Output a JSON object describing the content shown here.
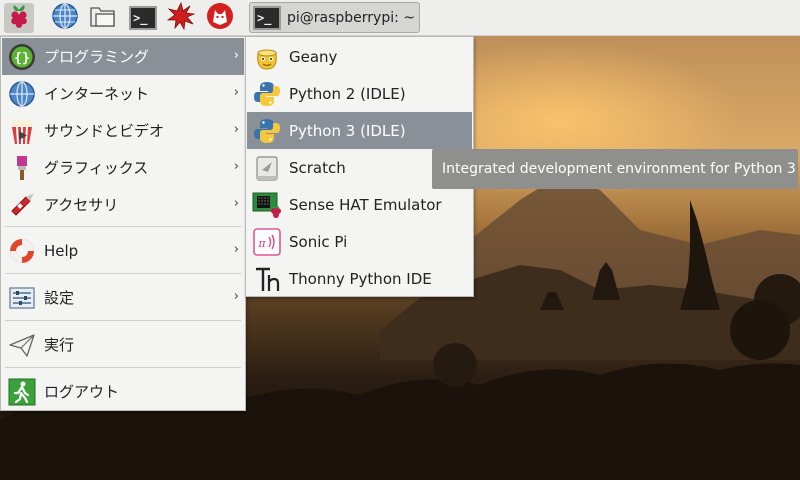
{
  "panel": {
    "launchers": [
      {
        "icon": "raspberry-icon",
        "name": "menu-button"
      },
      {
        "icon": "globe-icon",
        "name": "web-browser-launcher"
      },
      {
        "icon": "folder-icon",
        "name": "file-manager-launcher"
      },
      {
        "icon": "terminal-icon",
        "name": "terminal-launcher"
      },
      {
        "icon": "starburst-icon",
        "name": "mathematica-launcher"
      },
      {
        "icon": "wolf-icon",
        "name": "wolfram-launcher"
      }
    ],
    "task": {
      "title": "pi@raspberrypi: ~"
    }
  },
  "main_menu": {
    "items": [
      {
        "label": "プログラミング",
        "icon": "braces-icon",
        "submenu": true,
        "selected": true
      },
      {
        "label": "インターネット",
        "icon": "globe-icon",
        "submenu": true
      },
      {
        "label": "サウンドとビデオ",
        "icon": "popcorn-icon",
        "submenu": true
      },
      {
        "label": "グラフィックス",
        "icon": "paintbrush-icon",
        "submenu": true
      },
      {
        "label": "アクセサリ",
        "icon": "swiss-knife-icon",
        "submenu": true
      },
      {
        "label": "Help",
        "icon": "lifebuoy-icon",
        "submenu": true
      },
      {
        "label": "設定",
        "icon": "settings-icon",
        "submenu": true
      },
      {
        "label": "実行",
        "icon": "paper-plane-icon",
        "submenu": false
      },
      {
        "label": "ログアウト",
        "icon": "exit-icon",
        "submenu": false
      }
    ],
    "arrow": "›"
  },
  "sub_menu": {
    "items": [
      {
        "label": "Geany",
        "icon": "geany-icon"
      },
      {
        "label": "Python 2 (IDLE)",
        "icon": "python-icon"
      },
      {
        "label": "Python 3 (IDLE)",
        "icon": "python-icon",
        "selected": true
      },
      {
        "label": "Scratch",
        "icon": "scratch-icon"
      },
      {
        "label": "Sense HAT Emulator",
        "icon": "sense-hat-icon"
      },
      {
        "label": "Sonic Pi",
        "icon": "sonic-pi-icon"
      },
      {
        "label": "Thonny Python IDE",
        "icon": "thonny-icon"
      }
    ]
  },
  "tooltip": {
    "text": "Integrated development environment for Python 3"
  },
  "colors": {
    "selection": "#8a9097",
    "panel_bg": "#eeeeec",
    "menu_bg": "#f4f4f3",
    "tooltip_bg": "#8f8f8e"
  }
}
